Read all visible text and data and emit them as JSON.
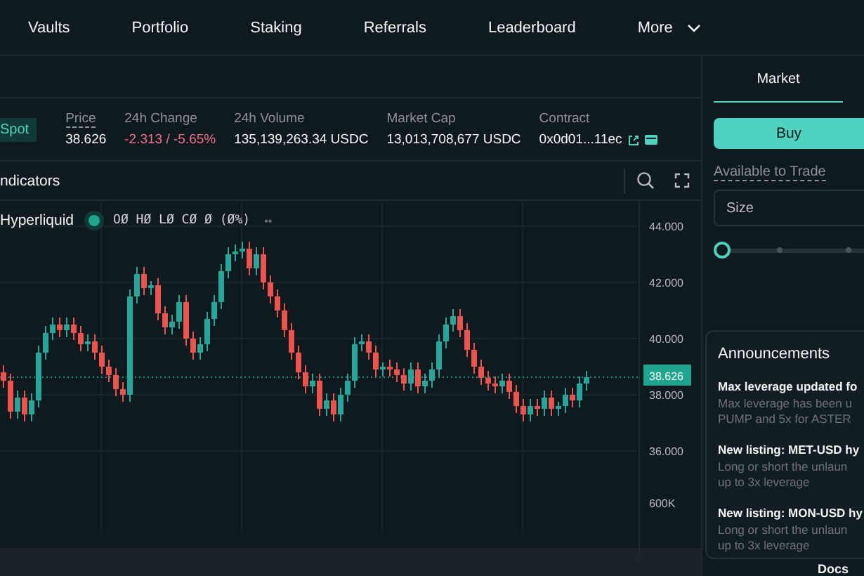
{
  "nav": {
    "items": [
      "Vaults",
      "Portfolio",
      "Staking",
      "Referrals",
      "Leaderboard",
      "More"
    ]
  },
  "market": {
    "badge": "Spot",
    "stats": [
      {
        "label": "Price",
        "value": "38.626",
        "negative": false,
        "underlined": true
      },
      {
        "label": "24h Change",
        "value": "-2.313 / -5.65%",
        "negative": true,
        "underlined": false
      },
      {
        "label": "24h Volume",
        "value": "135,139,263.34 USDC",
        "negative": false,
        "underlined": false
      },
      {
        "label": "Market Cap",
        "value": "13,013,708,677 USDC",
        "negative": false,
        "underlined": false
      },
      {
        "label": "Contract",
        "value": "0x0d01...11ec",
        "negative": false,
        "underlined": false
      }
    ]
  },
  "chart": {
    "toolbar_label": "ndicators",
    "source": "Hyperliquid",
    "ohlc": "OØ HØ LØ CØ Ø (Ø%)",
    "more": "••",
    "volume_tick": "600K",
    "chart_data": {
      "type": "candlestick",
      "grid": true,
      "ylim": [
        32.15,
        44.9
      ],
      "yticks": [
        {
          "value": 44,
          "label": "44.000"
        },
        {
          "value": 42,
          "label": "42.000"
        },
        {
          "value": 40,
          "label": "40.000"
        },
        {
          "value": 38,
          "label": "38.000"
        },
        {
          "value": 36,
          "label": "36.000"
        }
      ],
      "ref_lines": [
        {
          "axis": "y",
          "value": 38.626,
          "label": "38.626"
        }
      ],
      "categories": [
        null,
        null,
        null,
        null,
        null,
        null,
        null,
        null,
        null,
        null,
        null,
        null,
        null,
        null,
        null,
        null,
        null,
        null,
        null,
        null,
        null,
        null,
        null,
        null,
        null,
        null,
        null,
        null,
        null,
        null,
        null,
        null,
        null,
        null,
        null,
        null,
        null,
        null,
        null,
        null,
        null,
        null,
        null,
        null,
        null,
        null,
        null,
        null,
        null,
        null,
        null,
        null,
        null,
        null,
        null,
        null,
        null,
        null,
        null,
        null,
        null,
        null,
        null,
        null,
        null,
        null,
        null,
        null,
        null,
        null,
        null,
        null,
        null,
        null,
        null,
        null,
        null,
        null,
        null,
        null,
        null,
        null,
        null,
        null,
        null,
        null,
        null,
        null,
        null,
        null,
        null
      ],
      "ohlc": [
        [
          38.8,
          39.05,
          38.25,
          38.5
        ],
        [
          38.5,
          38.75,
          37.15,
          37.4
        ],
        [
          37.4,
          38.15,
          37.15,
          37.9
        ],
        [
          37.9,
          38.15,
          37.05,
          37.3
        ],
        [
          37.3,
          38.05,
          37.05,
          37.8
        ],
        [
          37.8,
          39.75,
          37.55,
          39.5
        ],
        [
          39.5,
          40.45,
          39.25,
          40.2
        ],
        [
          40.2,
          40.75,
          39.95,
          40.5
        ],
        [
          40.5,
          40.75,
          40.05,
          40.3
        ],
        [
          40.3,
          40.75,
          40.05,
          40.5
        ],
        [
          40.5,
          40.75,
          39.95,
          40.2
        ],
        [
          40.2,
          40.45,
          39.55,
          39.8
        ],
        [
          39.8,
          40.15,
          39.55,
          39.9
        ],
        [
          39.9,
          40.15,
          39.25,
          39.5
        ],
        [
          39.5,
          39.75,
          38.75,
          39.0
        ],
        [
          39.0,
          39.25,
          38.45,
          38.7
        ],
        [
          38.7,
          38.95,
          37.95,
          38.2
        ],
        [
          38.2,
          38.45,
          37.75,
          38.0
        ],
        [
          38.0,
          41.75,
          37.75,
          41.5
        ],
        [
          41.5,
          42.55,
          41.25,
          42.3
        ],
        [
          42.3,
          42.55,
          41.55,
          41.8
        ],
        [
          41.8,
          42.05,
          41.55,
          41.9
        ],
        [
          41.9,
          42.15,
          40.65,
          40.9
        ],
        [
          40.9,
          41.15,
          40.15,
          40.4
        ],
        [
          40.4,
          40.85,
          40.15,
          40.6
        ],
        [
          40.6,
          41.55,
          40.35,
          41.3
        ],
        [
          41.3,
          41.55,
          39.75,
          40.0
        ],
        [
          40.0,
          40.25,
          39.25,
          39.5
        ],
        [
          39.5,
          40.05,
          39.25,
          39.8
        ],
        [
          39.8,
          40.95,
          39.55,
          40.7
        ],
        [
          40.7,
          41.55,
          40.45,
          41.3
        ],
        [
          41.3,
          42.65,
          41.05,
          42.4
        ],
        [
          42.4,
          43.25,
          42.15,
          43.0
        ],
        [
          43.0,
          43.35,
          42.75,
          43.1
        ],
        [
          43.1,
          43.45,
          42.85,
          43.2
        ],
        [
          43.2,
          43.45,
          42.25,
          42.5
        ],
        [
          42.5,
          43.25,
          42.25,
          43.0
        ],
        [
          43.0,
          43.25,
          41.75,
          42.0
        ],
        [
          42.0,
          42.25,
          41.25,
          41.5
        ],
        [
          41.5,
          41.75,
          40.75,
          41.0
        ],
        [
          41.0,
          41.25,
          40.05,
          40.3
        ],
        [
          40.3,
          40.55,
          39.25,
          39.5
        ],
        [
          39.5,
          39.75,
          38.55,
          38.8
        ],
        [
          38.8,
          39.05,
          38.05,
          38.3
        ],
        [
          38.3,
          38.75,
          38.05,
          38.5
        ],
        [
          38.5,
          38.75,
          37.25,
          37.5
        ],
        [
          37.5,
          38.05,
          37.25,
          37.8
        ],
        [
          37.8,
          38.05,
          37.05,
          37.3
        ],
        [
          37.3,
          38.25,
          37.05,
          38.0
        ],
        [
          38.0,
          38.75,
          37.75,
          38.5
        ],
        [
          38.5,
          40.05,
          38.25,
          39.8
        ],
        [
          39.8,
          40.15,
          39.55,
          39.9
        ],
        [
          39.9,
          40.15,
          39.25,
          39.5
        ],
        [
          39.5,
          39.75,
          38.65,
          38.9
        ],
        [
          38.9,
          39.15,
          38.65,
          39.0
        ],
        [
          39.0,
          39.25,
          38.65,
          38.9
        ],
        [
          38.9,
          39.15,
          38.45,
          38.7
        ],
        [
          38.7,
          38.95,
          38.15,
          38.4
        ],
        [
          38.4,
          39.15,
          38.15,
          38.9
        ],
        [
          38.9,
          39.15,
          38.05,
          38.3
        ],
        [
          38.3,
          38.75,
          38.05,
          38.5
        ],
        [
          38.5,
          39.15,
          38.25,
          38.9
        ],
        [
          38.9,
          40.15,
          38.65,
          39.9
        ],
        [
          39.9,
          40.75,
          39.65,
          40.5
        ],
        [
          40.5,
          41.05,
          40.25,
          40.8
        ],
        [
          40.8,
          41.05,
          40.05,
          40.3
        ],
        [
          40.3,
          40.55,
          39.35,
          39.6
        ],
        [
          39.6,
          39.85,
          38.75,
          39.0
        ],
        [
          39.0,
          39.25,
          38.35,
          38.6
        ],
        [
          38.6,
          38.85,
          38.15,
          38.4
        ],
        [
          38.4,
          38.65,
          38.05,
          38.3
        ],
        [
          38.3,
          38.75,
          38.05,
          38.5
        ],
        [
          38.5,
          38.75,
          37.85,
          38.1
        ],
        [
          38.1,
          38.35,
          37.35,
          37.6
        ],
        [
          37.6,
          37.85,
          37.05,
          37.3
        ],
        [
          37.3,
          37.85,
          37.05,
          37.6
        ],
        [
          37.6,
          37.85,
          37.25,
          37.5
        ],
        [
          37.5,
          38.15,
          37.25,
          37.9
        ],
        [
          37.9,
          38.15,
          37.25,
          37.5
        ],
        [
          37.5,
          37.75,
          37.25,
          37.6
        ],
        [
          37.6,
          38.25,
          37.35,
          38.0
        ],
        [
          38.0,
          38.25,
          37.55,
          37.8
        ],
        [
          37.8,
          38.65,
          37.55,
          38.4
        ],
        [
          38.4,
          38.85,
          38.15,
          38.626
        ],
        null,
        null,
        null,
        null,
        null,
        null,
        null
      ]
    }
  },
  "order": {
    "tabs": [
      {
        "label": "Market",
        "selected": true
      }
    ],
    "buy": "Buy",
    "available": "Available to Trade",
    "size_placeholder": "Size",
    "slider": {
      "level": 0
    }
  },
  "announcements": {
    "title": "Announcements",
    "items": [
      {
        "title": "Max leverage updated fo",
        "body": "Max leverage has been u PUMP and 5x for ASTER"
      },
      {
        "title": "New listing: MET-USD hy",
        "body": "Long or short the unlaun up to 3x leverage"
      },
      {
        "title": "New listing: MON-USD hy",
        "body": "Long or short the unlaun up to 3x leverage"
      }
    ]
  },
  "footer": {
    "link": "Docs"
  }
}
